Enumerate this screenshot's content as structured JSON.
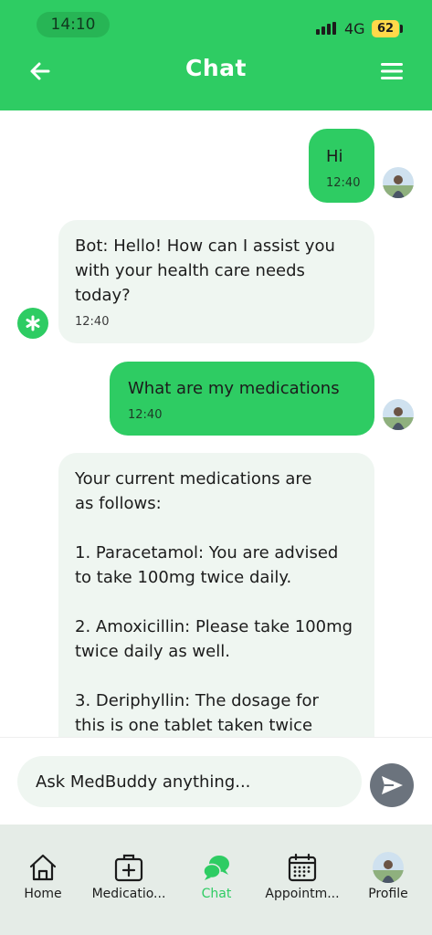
{
  "status_bar": {
    "time": "14:10",
    "network": "4G",
    "battery": "62"
  },
  "header": {
    "title": "Chat",
    "back_icon": "arrow-left-icon",
    "menu_icon": "hamburger-menu-icon"
  },
  "messages": [
    {
      "sender": "user",
      "text": "Hi",
      "time": "12:40"
    },
    {
      "sender": "bot",
      "text": "Bot: Hello! How can I assist you\nwith your health care needs\ntoday?",
      "time": "12:40"
    },
    {
      "sender": "user",
      "text": "What are my medications",
      "time": "12:40"
    },
    {
      "sender": "bot",
      "text": "Your current medications are\nas follows:\n\n1. Paracetamol: You are advised\nto take 100mg twice daily.\n\n2. Amoxicillin: Please take 100mg\ntwice daily as well.\n\n3. Deriphyllin: The dosage for\nthis is one tablet taken twice",
      "time": ""
    }
  ],
  "input": {
    "placeholder": "Ask MedBuddy anything..."
  },
  "nav": {
    "items": [
      {
        "label": "Home",
        "icon": "home-icon"
      },
      {
        "label": "Medicatio...",
        "icon": "medical-kit-icon"
      },
      {
        "label": "Chat",
        "icon": "chat-bubbles-icon"
      },
      {
        "label": "Appointm...",
        "icon": "calendar-icon"
      },
      {
        "label": "Profile",
        "icon": "profile-avatar"
      }
    ]
  },
  "colors": {
    "primary_green": "#2ecc63",
    "bot_bubble": "#eff6f1",
    "nav_bg": "#e5ece7",
    "send_button": "#6b737d"
  }
}
